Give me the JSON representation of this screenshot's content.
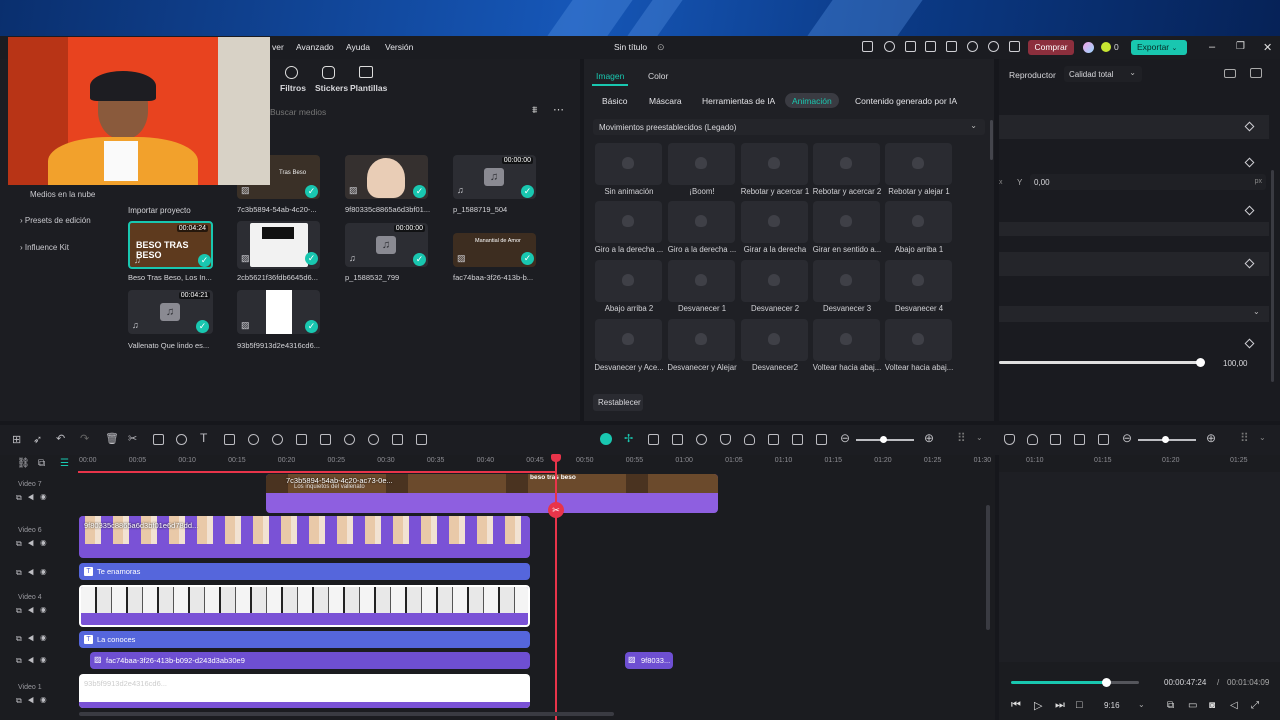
{
  "titlebar": {
    "menus": [
      "ver",
      "Avanzado",
      "Ayuda",
      "Versión"
    ],
    "project_title": "Sin título",
    "buy_label": "Comprar",
    "credits": "0",
    "export_label": "Exportar"
  },
  "media": {
    "tools": [
      "Filtros",
      "Stickers",
      "Plantillas"
    ],
    "search_placeholder": "Buscar medios",
    "nav": [
      "Medios en la nube",
      "Presets de edición",
      "Influence Kit"
    ],
    "import_label": "Importar proyecto",
    "items": [
      {
        "caption": "7c3b5894-54ab-4c20-...",
        "duration": "",
        "kind": "image",
        "thumb_text": "Tras Beso"
      },
      {
        "caption": "9f80335c8865a6d3bf01...",
        "duration": "",
        "kind": "image",
        "thumb_text": ""
      },
      {
        "caption": "p_1588719_504",
        "duration": "00:00:00",
        "kind": "audio",
        "thumb_text": ""
      },
      {
        "caption": "Beso Tras Beso, Los In...",
        "duration": "00:04:24",
        "kind": "audio",
        "thumb_text": "BESO TRAS BESO"
      },
      {
        "caption": "2cb5621f36fdb6645d6...",
        "duration": "",
        "kind": "image",
        "thumb_text": ""
      },
      {
        "caption": "p_1588532_799",
        "duration": "00:00:00",
        "kind": "audio",
        "thumb_text": ""
      },
      {
        "caption": "fac74baa-3f26-413b-b...",
        "duration": "",
        "kind": "image",
        "thumb_text": "Manantial de Amor"
      },
      {
        "caption": "Vallenato Que lindo es...",
        "duration": "00:04:21",
        "kind": "audio",
        "thumb_text": ""
      },
      {
        "caption": "93b5f9913d2e4316cd6...",
        "duration": "",
        "kind": "image",
        "thumb_text": ""
      }
    ]
  },
  "props": {
    "tabs": [
      "Imagen",
      "Color"
    ],
    "subtabs": [
      "Básico",
      "Máscara",
      "Herramientas de IA",
      "Animación",
      "Contenido generado por IA"
    ],
    "active_subtab": "Animación",
    "preset_dropdown": "Movimientos preestablecidos (Legado)",
    "animations": [
      "Sin animación",
      "¡Boom!",
      "Rebotar y acercar 1",
      "Rebotar y acercar 2",
      "Rebotar y alejar 1",
      "Giro a la derecha ...",
      "Giro a la derecha ...",
      "Girar a la derecha",
      "Girar en sentido a...",
      "Abajo arriba 1",
      "Abajo arriba 2",
      "Desvanecer 1",
      "Desvanecer 2",
      "Desvanecer 3",
      "Desvanecer 4",
      "Desvanecer y Ace...",
      "Desvanecer y Alejar",
      "Desvanecer2",
      "Voltear hacia abaj...",
      "Voltear hacia abaj..."
    ],
    "reset_label": "Restablecer"
  },
  "player": {
    "label": "Reproductor",
    "quality": "Calidad total",
    "y_label": "Y",
    "y_value": "0,00",
    "y_unit": "px",
    "scale_value": "100,00",
    "scale_level": 1.0,
    "current_time": "00:00:47:24",
    "separator": "/",
    "total_time": "00:01:04:09",
    "progress": 0.74,
    "ratio": "9:16"
  },
  "timeline": {
    "ruler": [
      "00:00",
      "00:05",
      "00:10",
      "00:15",
      "00:20",
      "00:25",
      "00:30",
      "00:35",
      "00:40",
      "00:45",
      "00:50",
      "00:55",
      "01:00",
      "01:05",
      "01:10",
      "01:15",
      "01:20",
      "01:25",
      "01:30"
    ],
    "preview_ruler": [
      "01:10",
      "01:15",
      "01:20",
      "01:25"
    ],
    "tracks": [
      "Video 7",
      "Video 6",
      "Video 4",
      "Video 1"
    ],
    "clips": {
      "top_clip": "7c3b5894-54ab-4c20-ac73-0e...",
      "top_clip_sub": "Los inquietos del vallenato",
      "top_clip_title": "beso tras beso",
      "sticker_clip": "9f80335c8865a6d3bf01e6d78dd...",
      "text_clip_1": "Te enamoras",
      "text_clip_2": "La conoces",
      "image_clip": "fac74baa-3f26-413b-b092-d243d3ab30e9",
      "small_clip": "9f8033...",
      "white_clip": "93b5f9913d2e4316cd6..."
    }
  },
  "colors": {
    "accent": "#19c7b0",
    "clip": "#7a52d6",
    "playhead": "#e8344a",
    "buy": "#8c2f3d"
  }
}
